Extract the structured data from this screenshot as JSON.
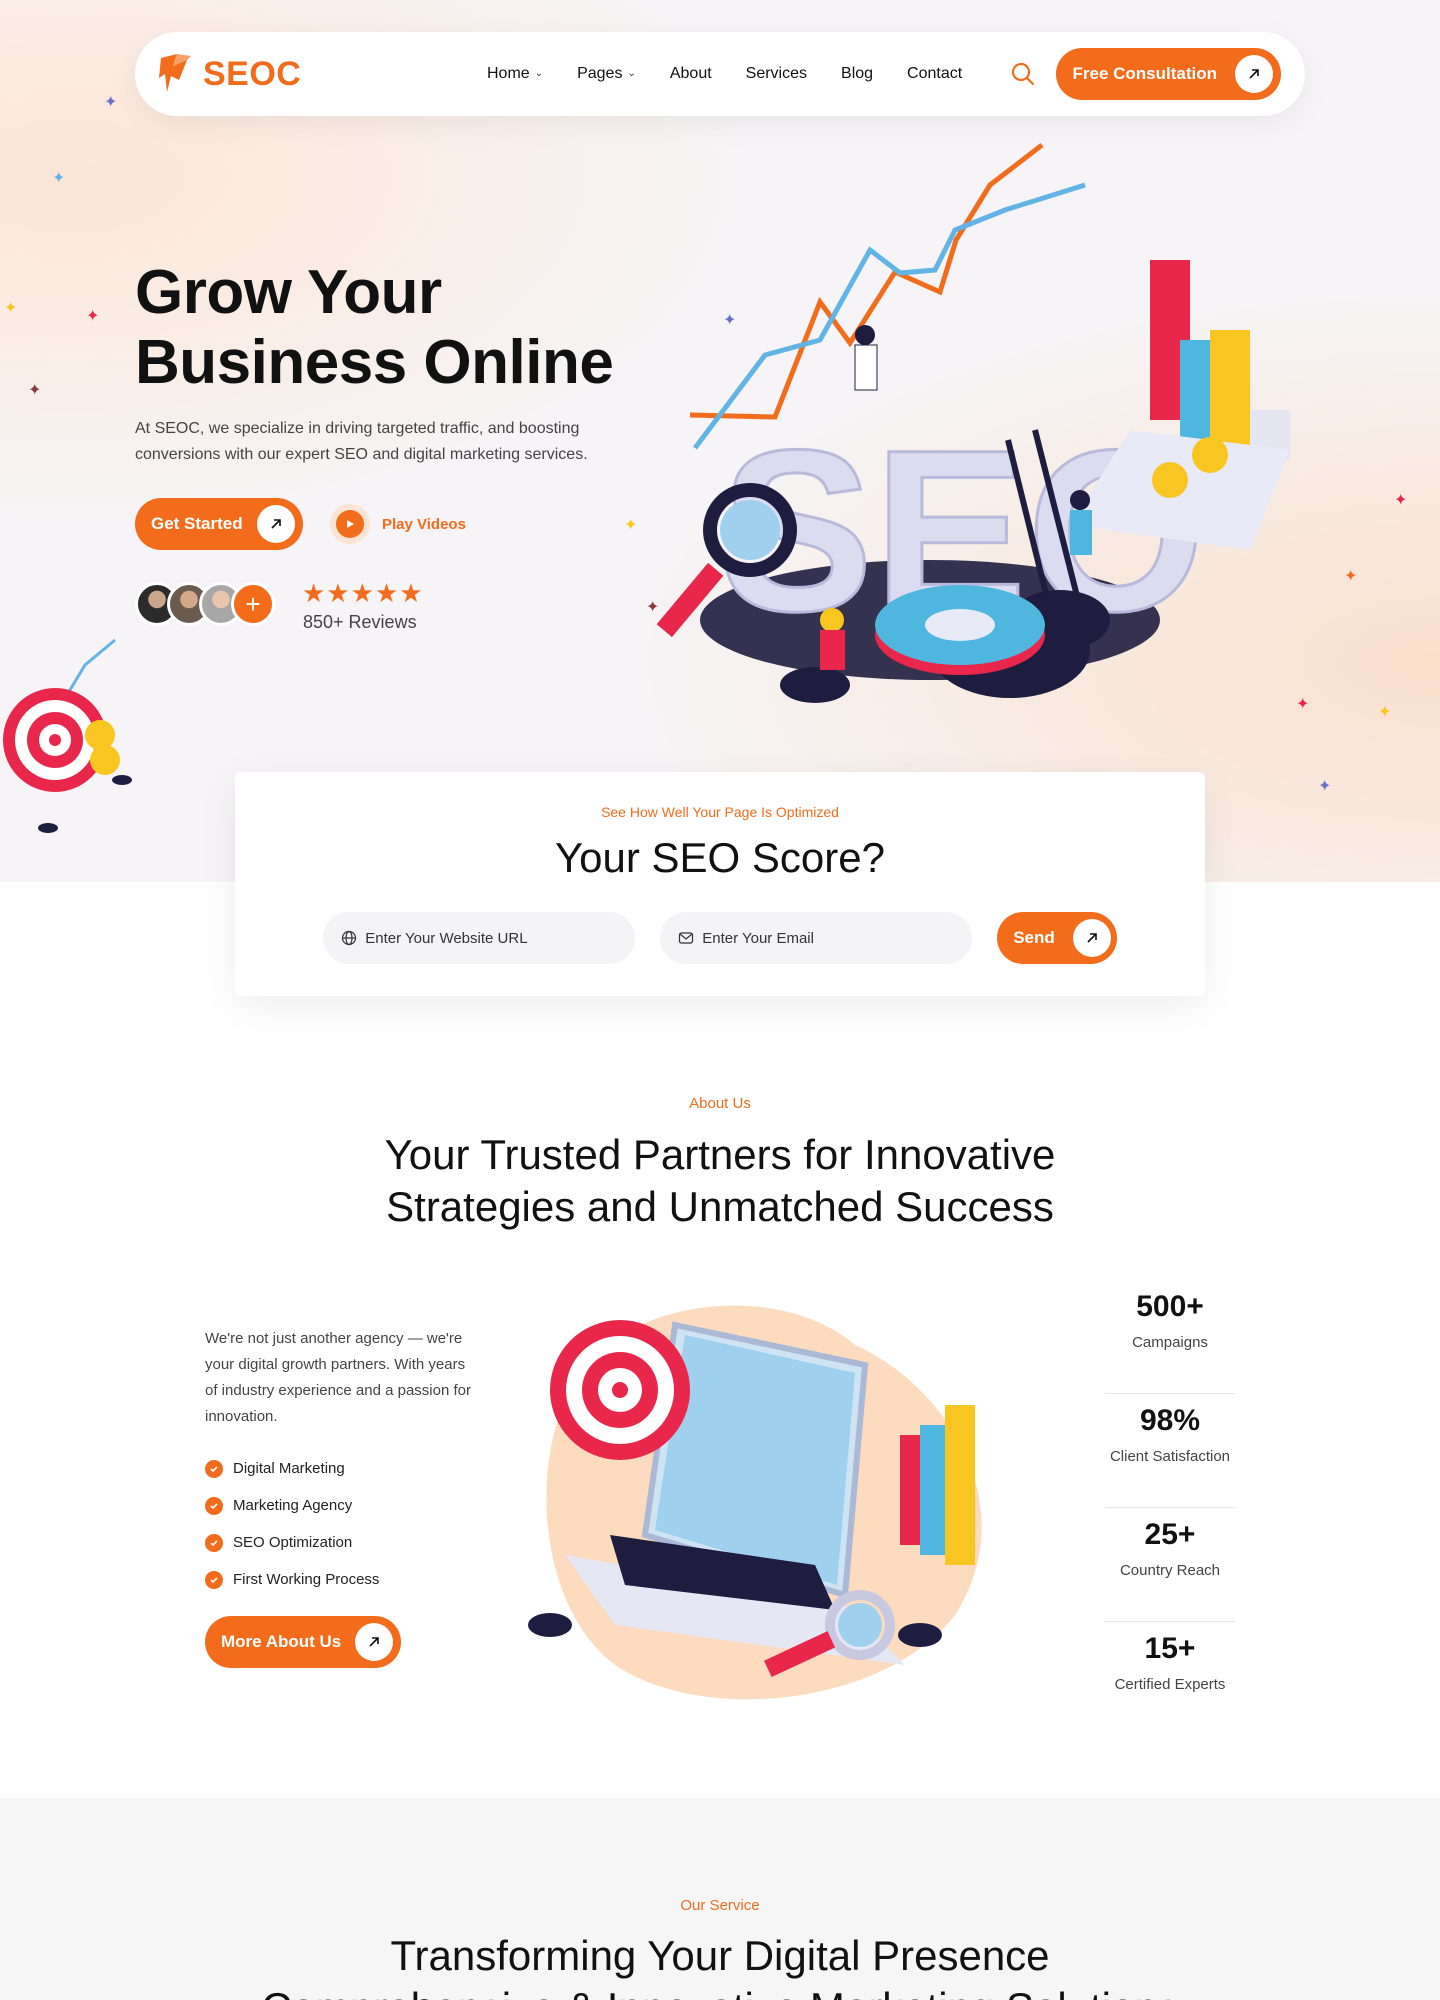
{
  "brand": {
    "name": "SEOC",
    "accent": "#f26c1b"
  },
  "nav": {
    "items": [
      {
        "label": "Home",
        "dropdown": true
      },
      {
        "label": "Pages",
        "dropdown": true
      },
      {
        "label": "About",
        "dropdown": false
      },
      {
        "label": "Services",
        "dropdown": false
      },
      {
        "label": "Blog",
        "dropdown": false
      },
      {
        "label": "Contact",
        "dropdown": false
      }
    ],
    "cta": "Free Consultation"
  },
  "hero": {
    "title_line1": "Grow Your",
    "title_line2": "Business Online",
    "description": "At SEOC, we specialize in driving targeted traffic, and boosting conversions with our expert SEO and digital marketing services.",
    "primary_cta": "Get Started",
    "video_cta": "Play Videos",
    "rating_stars": 5,
    "reviews": "850+ Reviews"
  },
  "seo_score": {
    "subtitle": "See How Well Your Page Is Optimized",
    "title": "Your SEO Score?",
    "url_placeholder": "Enter Your Website URL",
    "email_placeholder": "Enter Your Email",
    "submit": "Send"
  },
  "about": {
    "subtitle": "About Us",
    "title_line1": "Your Trusted Partners for Innovative",
    "title_line2": "Strategies and Unmatched Success",
    "description": "We're not just another agency — we're your digital growth partners. With years of industry experience and a passion for innovation.",
    "checklist": [
      "Digital Marketing",
      "Marketing Agency",
      "SEO Optimization",
      "First Working Process"
    ],
    "cta": "More About Us",
    "stats": [
      {
        "value": "500+",
        "label": "Campaigns"
      },
      {
        "value": "98%",
        "label": "Client Satisfaction"
      },
      {
        "value": "25+",
        "label": "Country Reach"
      },
      {
        "value": "15+",
        "label": "Certified Experts"
      }
    ]
  },
  "services": {
    "subtitle": "Our Service",
    "title_line1": "Transforming Your Digital Presence",
    "title_line2": "Comprehensive & Innovative Marketing Solutions"
  }
}
